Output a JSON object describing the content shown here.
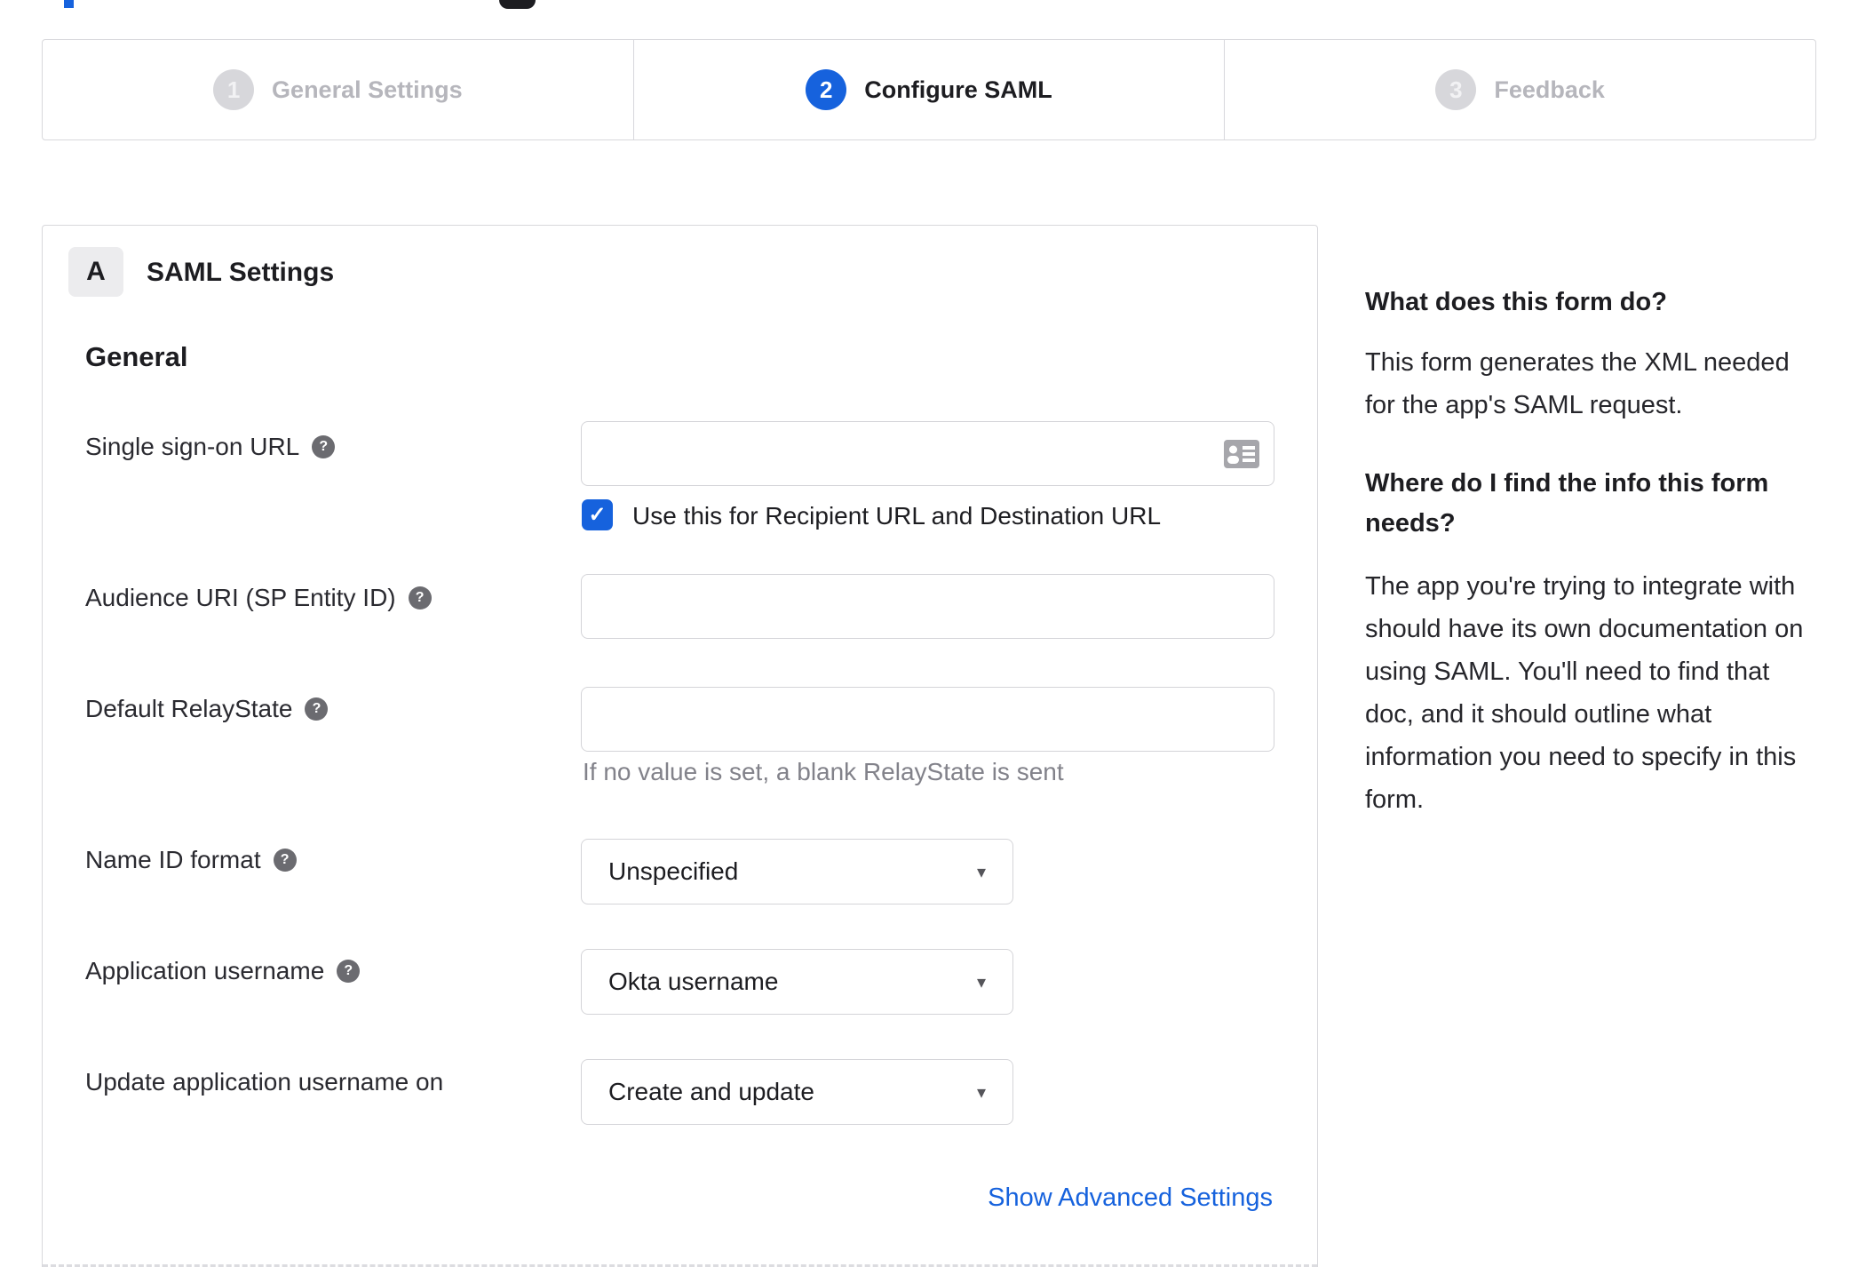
{
  "stepper": {
    "steps": [
      {
        "number": "1",
        "label": "General Settings",
        "active": false
      },
      {
        "number": "2",
        "label": "Configure SAML",
        "active": true
      },
      {
        "number": "3",
        "label": "Feedback",
        "active": false
      }
    ]
  },
  "panel": {
    "badge": "A",
    "title": "SAML Settings",
    "section": "General",
    "fields": {
      "sso_url": {
        "label": "Single sign-on URL",
        "value": "",
        "checkbox_label": "Use this for Recipient URL and Destination URL",
        "checkbox_checked": true
      },
      "audience_uri": {
        "label": "Audience URI (SP Entity ID)",
        "value": ""
      },
      "relay_state": {
        "label": "Default RelayState",
        "value": "",
        "hint": "If no value is set, a blank RelayState is sent"
      },
      "name_id_format": {
        "label": "Name ID format",
        "value": "Unspecified"
      },
      "app_username": {
        "label": "Application username",
        "value": "Okta username"
      },
      "update_app_username": {
        "label": "Update application username on",
        "value": "Create and update"
      }
    },
    "advanced_link": "Show Advanced Settings"
  },
  "sidebar": {
    "heading1": "What does this form do?",
    "body1": "This form generates the XML needed for the app's SAML request.",
    "heading2": "Where do I find the info this form needs?",
    "body2": "The app you're trying to integrate with should have its own documentation on using SAML. You'll need to find that doc, and it should outline what information you need to specify in this form."
  },
  "icons": {
    "help": "?",
    "check": "✓",
    "caret": "▾"
  },
  "colors": {
    "accent": "#1662dd",
    "text": "#1d1d21",
    "muted": "#b6b6bc",
    "hint": "#82828a",
    "border": "#d8d8dc"
  }
}
